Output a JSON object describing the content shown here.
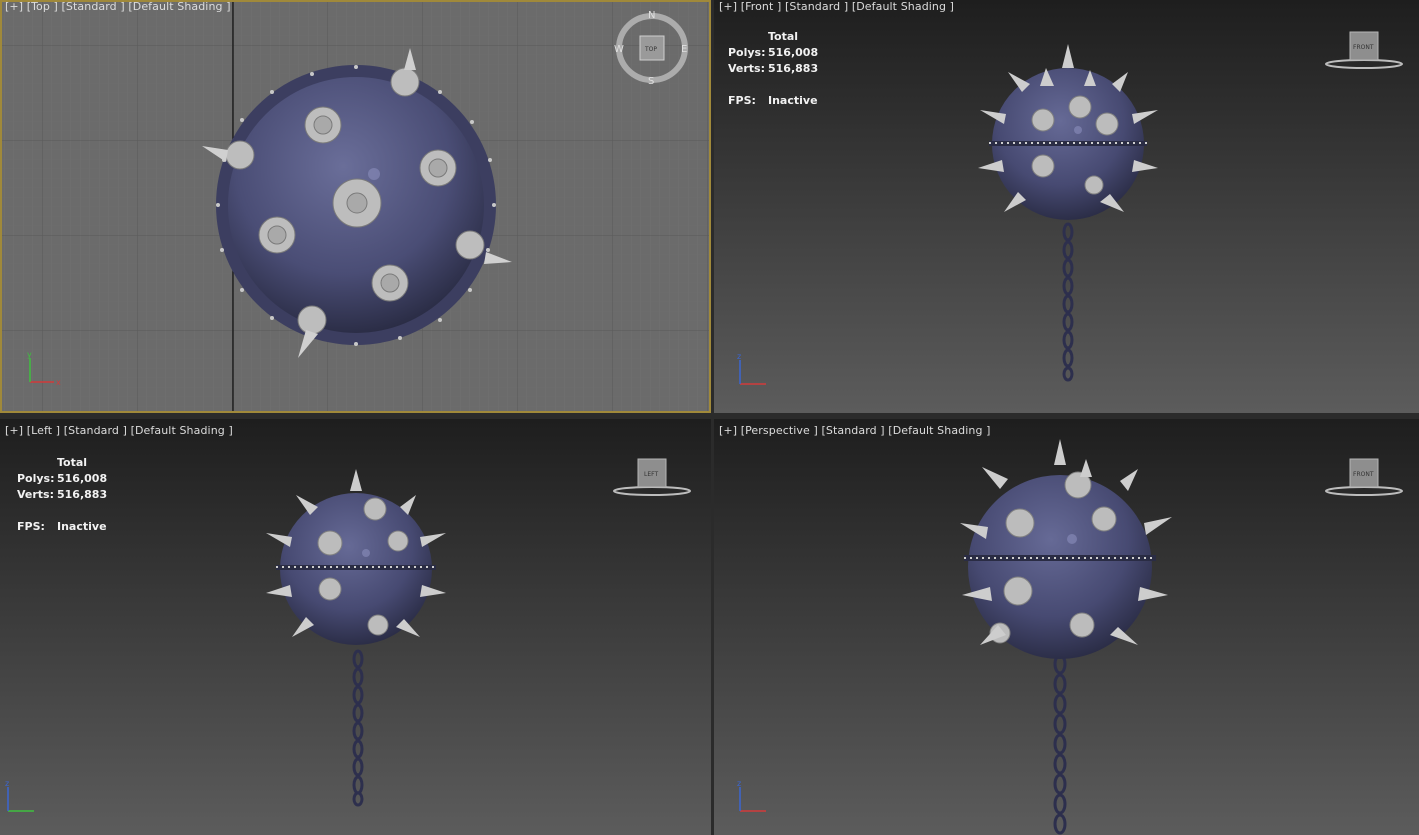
{
  "viewports": {
    "top": {
      "label": "[+] [Top ] [Standard ] [Default Shading ]"
    },
    "front": {
      "label": "[+] [Front ] [Standard ] [Default Shading ]"
    },
    "left": {
      "label": "[+] [Left ] [Standard ] [Default Shading ]"
    },
    "perspective": {
      "label": "[+] [Perspective ] [Standard ] [Default Shading ]"
    }
  },
  "stats": {
    "total_label": "Total",
    "polys_label": "Polys:",
    "polys_value": "516,008",
    "verts_label": "Verts:",
    "verts_value": "516,883",
    "fps_label": "FPS:",
    "fps_value": "Inactive"
  },
  "compass": {
    "n": "N",
    "s": "S",
    "e": "E",
    "w": "W",
    "cube": "TOP"
  },
  "viewcube": {
    "front": "FRONT",
    "left": "LEFT"
  },
  "axis": {
    "x": "x",
    "y": "y",
    "z": "z"
  },
  "colors": {
    "active_border": "#a0893a",
    "mine_body": "#4c4f77",
    "spike": "#b8b8b8",
    "chain": "#3f4168"
  }
}
